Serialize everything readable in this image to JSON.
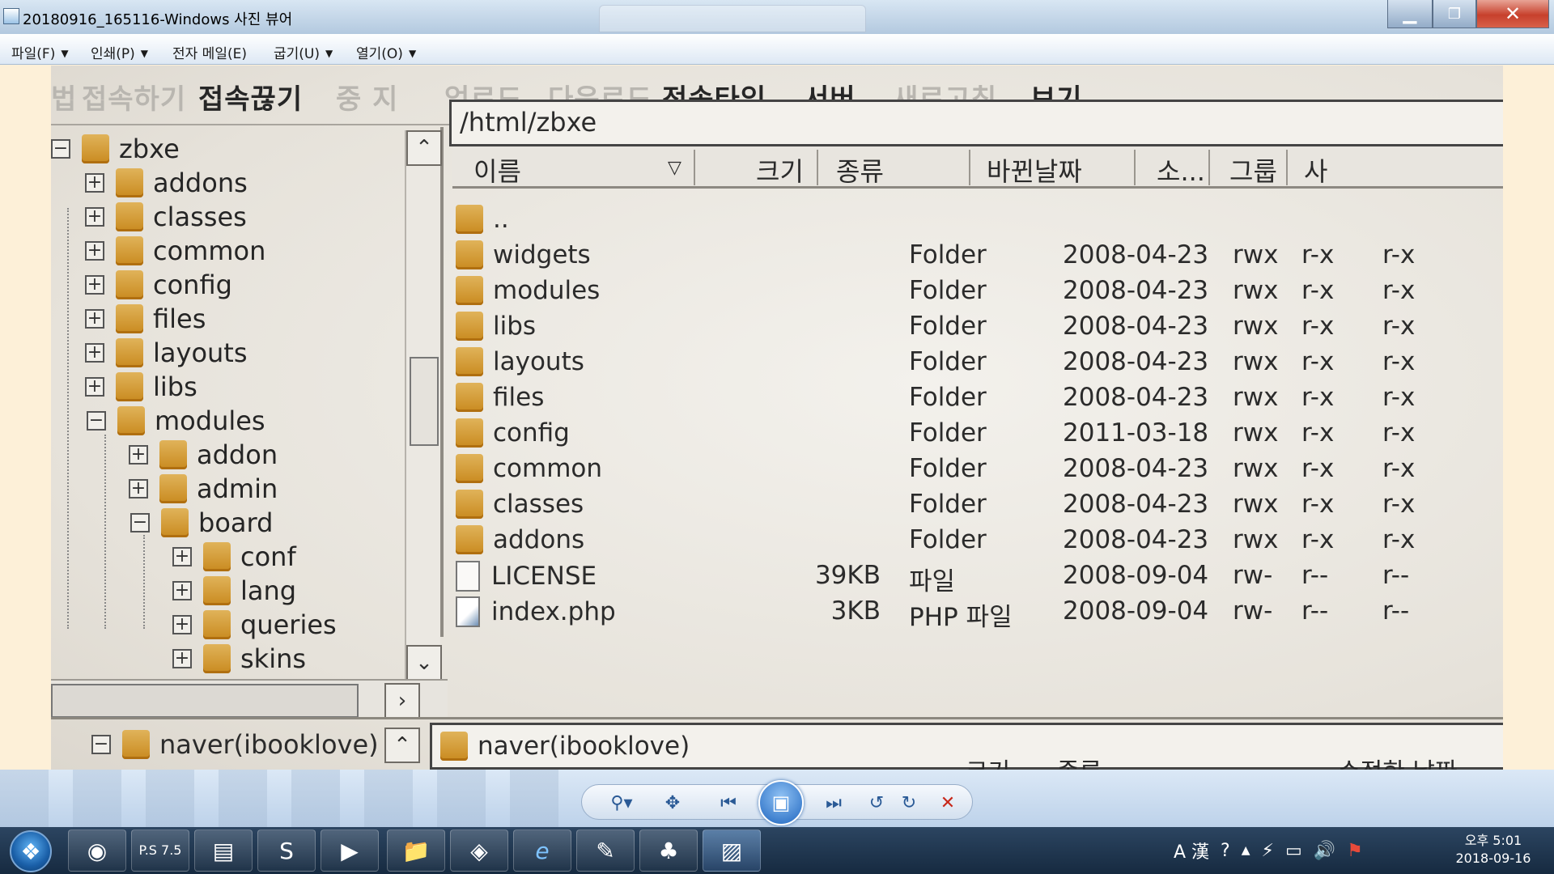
{
  "window": {
    "title": "20180916_165116-Windows 사진 뷰어",
    "minimize_glyph": "▁",
    "maximize_glyph": "❐",
    "close_glyph": "✕",
    "icon": "photo-viewer-icon"
  },
  "menubar": {
    "items": [
      {
        "label": "파일(F)",
        "has_dropdown": true
      },
      {
        "label": "인쇄(P)",
        "has_dropdown": true
      },
      {
        "label": "전자 메일(E)",
        "has_dropdown": false
      },
      {
        "label": "굽기(U)",
        "has_dropdown": true
      },
      {
        "label": "열기(O)",
        "has_dropdown": true
      }
    ],
    "help_label": "?"
  },
  "photo": {
    "ftp_toolbar": [
      {
        "label": "접속하기",
        "enabled": false
      },
      {
        "label": "접속끊기",
        "enabled": true
      },
      {
        "label": "중 지",
        "enabled": false
      },
      {
        "label": "업로드",
        "enabled": false
      },
      {
        "label": "다운로드",
        "enabled": false
      },
      {
        "label": "전송타입",
        "enabled": true
      },
      {
        "label": "서버",
        "enabled": true
      },
      {
        "label": "새로고침",
        "enabled": false
      },
      {
        "label": "보기",
        "enabled": true
      }
    ],
    "tree": {
      "root": "zbxe",
      "items": [
        {
          "label": "addons",
          "toggle": "+"
        },
        {
          "label": "classes",
          "toggle": "+"
        },
        {
          "label": "common",
          "toggle": "+"
        },
        {
          "label": "config",
          "toggle": "+"
        },
        {
          "label": "files",
          "toggle": "+"
        },
        {
          "label": "layouts",
          "toggle": "+"
        },
        {
          "label": "libs",
          "toggle": "+"
        },
        {
          "label": "modules",
          "toggle": "−"
        },
        {
          "label": "addon",
          "toggle": "+"
        },
        {
          "label": "admin",
          "toggle": "+"
        },
        {
          "label": "board",
          "toggle": "−"
        },
        {
          "label": "conf",
          "toggle": "+"
        },
        {
          "label": "lang",
          "toggle": "+"
        },
        {
          "label": "queries",
          "toggle": "+"
        },
        {
          "label": "skins",
          "toggle": "+"
        }
      ],
      "bottom_node": "naver(ibooklove)"
    },
    "path": "/html/zbxe",
    "columns": {
      "name": "이름",
      "size": "크기",
      "type": "종류",
      "date": "바뀐날짜",
      "owner": "소...",
      "group": "그룹",
      "other": "사"
    },
    "files": [
      {
        "name": "..",
        "size": "",
        "type": "",
        "date": "",
        "owner": "",
        "group": "",
        "other": "",
        "icon": "folder"
      },
      {
        "name": "widgets",
        "size": "",
        "type": "Folder",
        "date": "2008-04-23",
        "owner": "rwx",
        "group": "r-x",
        "other": "r-x",
        "icon": "folder"
      },
      {
        "name": "modules",
        "size": "",
        "type": "Folder",
        "date": "2008-04-23",
        "owner": "rwx",
        "group": "r-x",
        "other": "r-x",
        "icon": "folder"
      },
      {
        "name": "libs",
        "size": "",
        "type": "Folder",
        "date": "2008-04-23",
        "owner": "rwx",
        "group": "r-x",
        "other": "r-x",
        "icon": "folder"
      },
      {
        "name": "layouts",
        "size": "",
        "type": "Folder",
        "date": "2008-04-23",
        "owner": "rwx",
        "group": "r-x",
        "other": "r-x",
        "icon": "folder"
      },
      {
        "name": "files",
        "size": "",
        "type": "Folder",
        "date": "2008-04-23",
        "owner": "rwx",
        "group": "r-x",
        "other": "r-x",
        "icon": "folder"
      },
      {
        "name": "config",
        "size": "",
        "type": "Folder",
        "date": "2011-03-18",
        "owner": "rwx",
        "group": "r-x",
        "other": "r-x",
        "icon": "folder"
      },
      {
        "name": "common",
        "size": "",
        "type": "Folder",
        "date": "2008-04-23",
        "owner": "rwx",
        "group": "r-x",
        "other": "r-x",
        "icon": "folder"
      },
      {
        "name": "classes",
        "size": "",
        "type": "Folder",
        "date": "2008-04-23",
        "owner": "rwx",
        "group": "r-x",
        "other": "r-x",
        "icon": "folder"
      },
      {
        "name": "addons",
        "size": "",
        "type": "Folder",
        "date": "2008-04-23",
        "owner": "rwx",
        "group": "r-x",
        "other": "r-x",
        "icon": "folder"
      },
      {
        "name": "LICENSE",
        "size": "39KB",
        "type": "파일",
        "date": "2008-09-04",
        "owner": "rw-",
        "group": "r--",
        "other": "r--",
        "icon": "file"
      },
      {
        "name": "index.php",
        "size": "3KB",
        "type": "PHP 파일",
        "date": "2008-09-04",
        "owner": "rw-",
        "group": "r--",
        "other": "r--",
        "icon": "php-file"
      }
    ],
    "bottom_path": "naver(ibooklove)",
    "bottom_columns": {
      "size": "크기",
      "type": "종류",
      "modified": "수정한 날짜"
    }
  },
  "controls": {
    "zoom": "⚲▾",
    "fit": "✥",
    "prev": "⏮",
    "slideshow": "▣",
    "next": "⏭",
    "rotate_ccw": "↺",
    "rotate_cw": "↻",
    "delete": "✕"
  },
  "taskbar": {
    "start": "❖",
    "apps": [
      {
        "name": "chrome",
        "glyph": "◉"
      },
      {
        "name": "ps",
        "glyph": "P.S 7.5"
      },
      {
        "name": "window-app",
        "glyph": "▤"
      },
      {
        "name": "s-app",
        "glyph": "S"
      },
      {
        "name": "media-player",
        "glyph": "▶"
      },
      {
        "name": "file-explorer",
        "glyph": "📁"
      },
      {
        "name": "red-app",
        "glyph": "◈"
      },
      {
        "name": "internet-explorer",
        "glyph": "e"
      },
      {
        "name": "editor-app",
        "glyph": "✎"
      },
      {
        "name": "people-app",
        "glyph": "♣"
      },
      {
        "name": "photo-viewer",
        "glyph": "▨",
        "active": true
      }
    ],
    "tray": {
      "ime": "A 漢",
      "help": "?",
      "show_hidden": "▲",
      "power": "⚡",
      "network": "▭",
      "volume": "🔊",
      "flag": "⚑"
    },
    "clock": {
      "time": "오후 5:01",
      "date": "2018-09-16"
    }
  }
}
